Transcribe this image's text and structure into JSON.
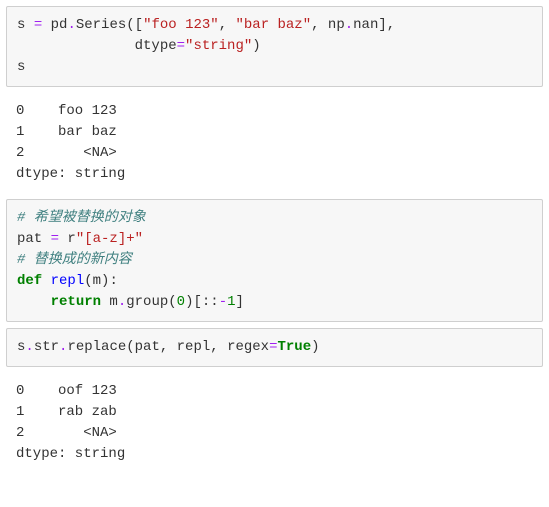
{
  "cell1": {
    "l1a": "s ",
    "l1b": "=",
    "l1c": " pd",
    "l1d": ".",
    "l1e": "Series([",
    "l1f": "\"foo 123\"",
    "l1g": ", ",
    "l1h": "\"bar baz\"",
    "l1i": ", np",
    "l1j": ".",
    "l1k": "nan],",
    "l2a": "              dtype",
    "l2b": "=",
    "l2c": "\"string\"",
    "l2d": ")",
    "l3a": "s"
  },
  "out1": {
    "text": "0    foo 123\n1    bar baz\n2       <NA>\ndtype: string"
  },
  "cell2": {
    "c1": "# 希望被替换的对象",
    "l2a": "pat ",
    "l2b": "=",
    "l2c": " r",
    "l2d": "\"[a-z]+\"",
    "c2": "# 替换成的新内容",
    "l4a": "def",
    "l4b": " ",
    "l4c": "repl",
    "l4d": "(m):",
    "l5a": "    ",
    "l5b": "return",
    "l5c": " m",
    "l5d": ".",
    "l5e": "group(",
    "l5f": "0",
    "l5g": ")[::",
    "l5h": "-",
    "l5i": "1",
    "l5j": "]"
  },
  "cell3": {
    "l1a": "s",
    "l1b": ".",
    "l1c": "str",
    "l1d": ".",
    "l1e": "replace(pat, repl, regex",
    "l1f": "=",
    "l1g": "True",
    "l1h": ")"
  },
  "out2": {
    "text": "0    oof 123\n1    rab zab\n2       <NA>\ndtype: string"
  }
}
